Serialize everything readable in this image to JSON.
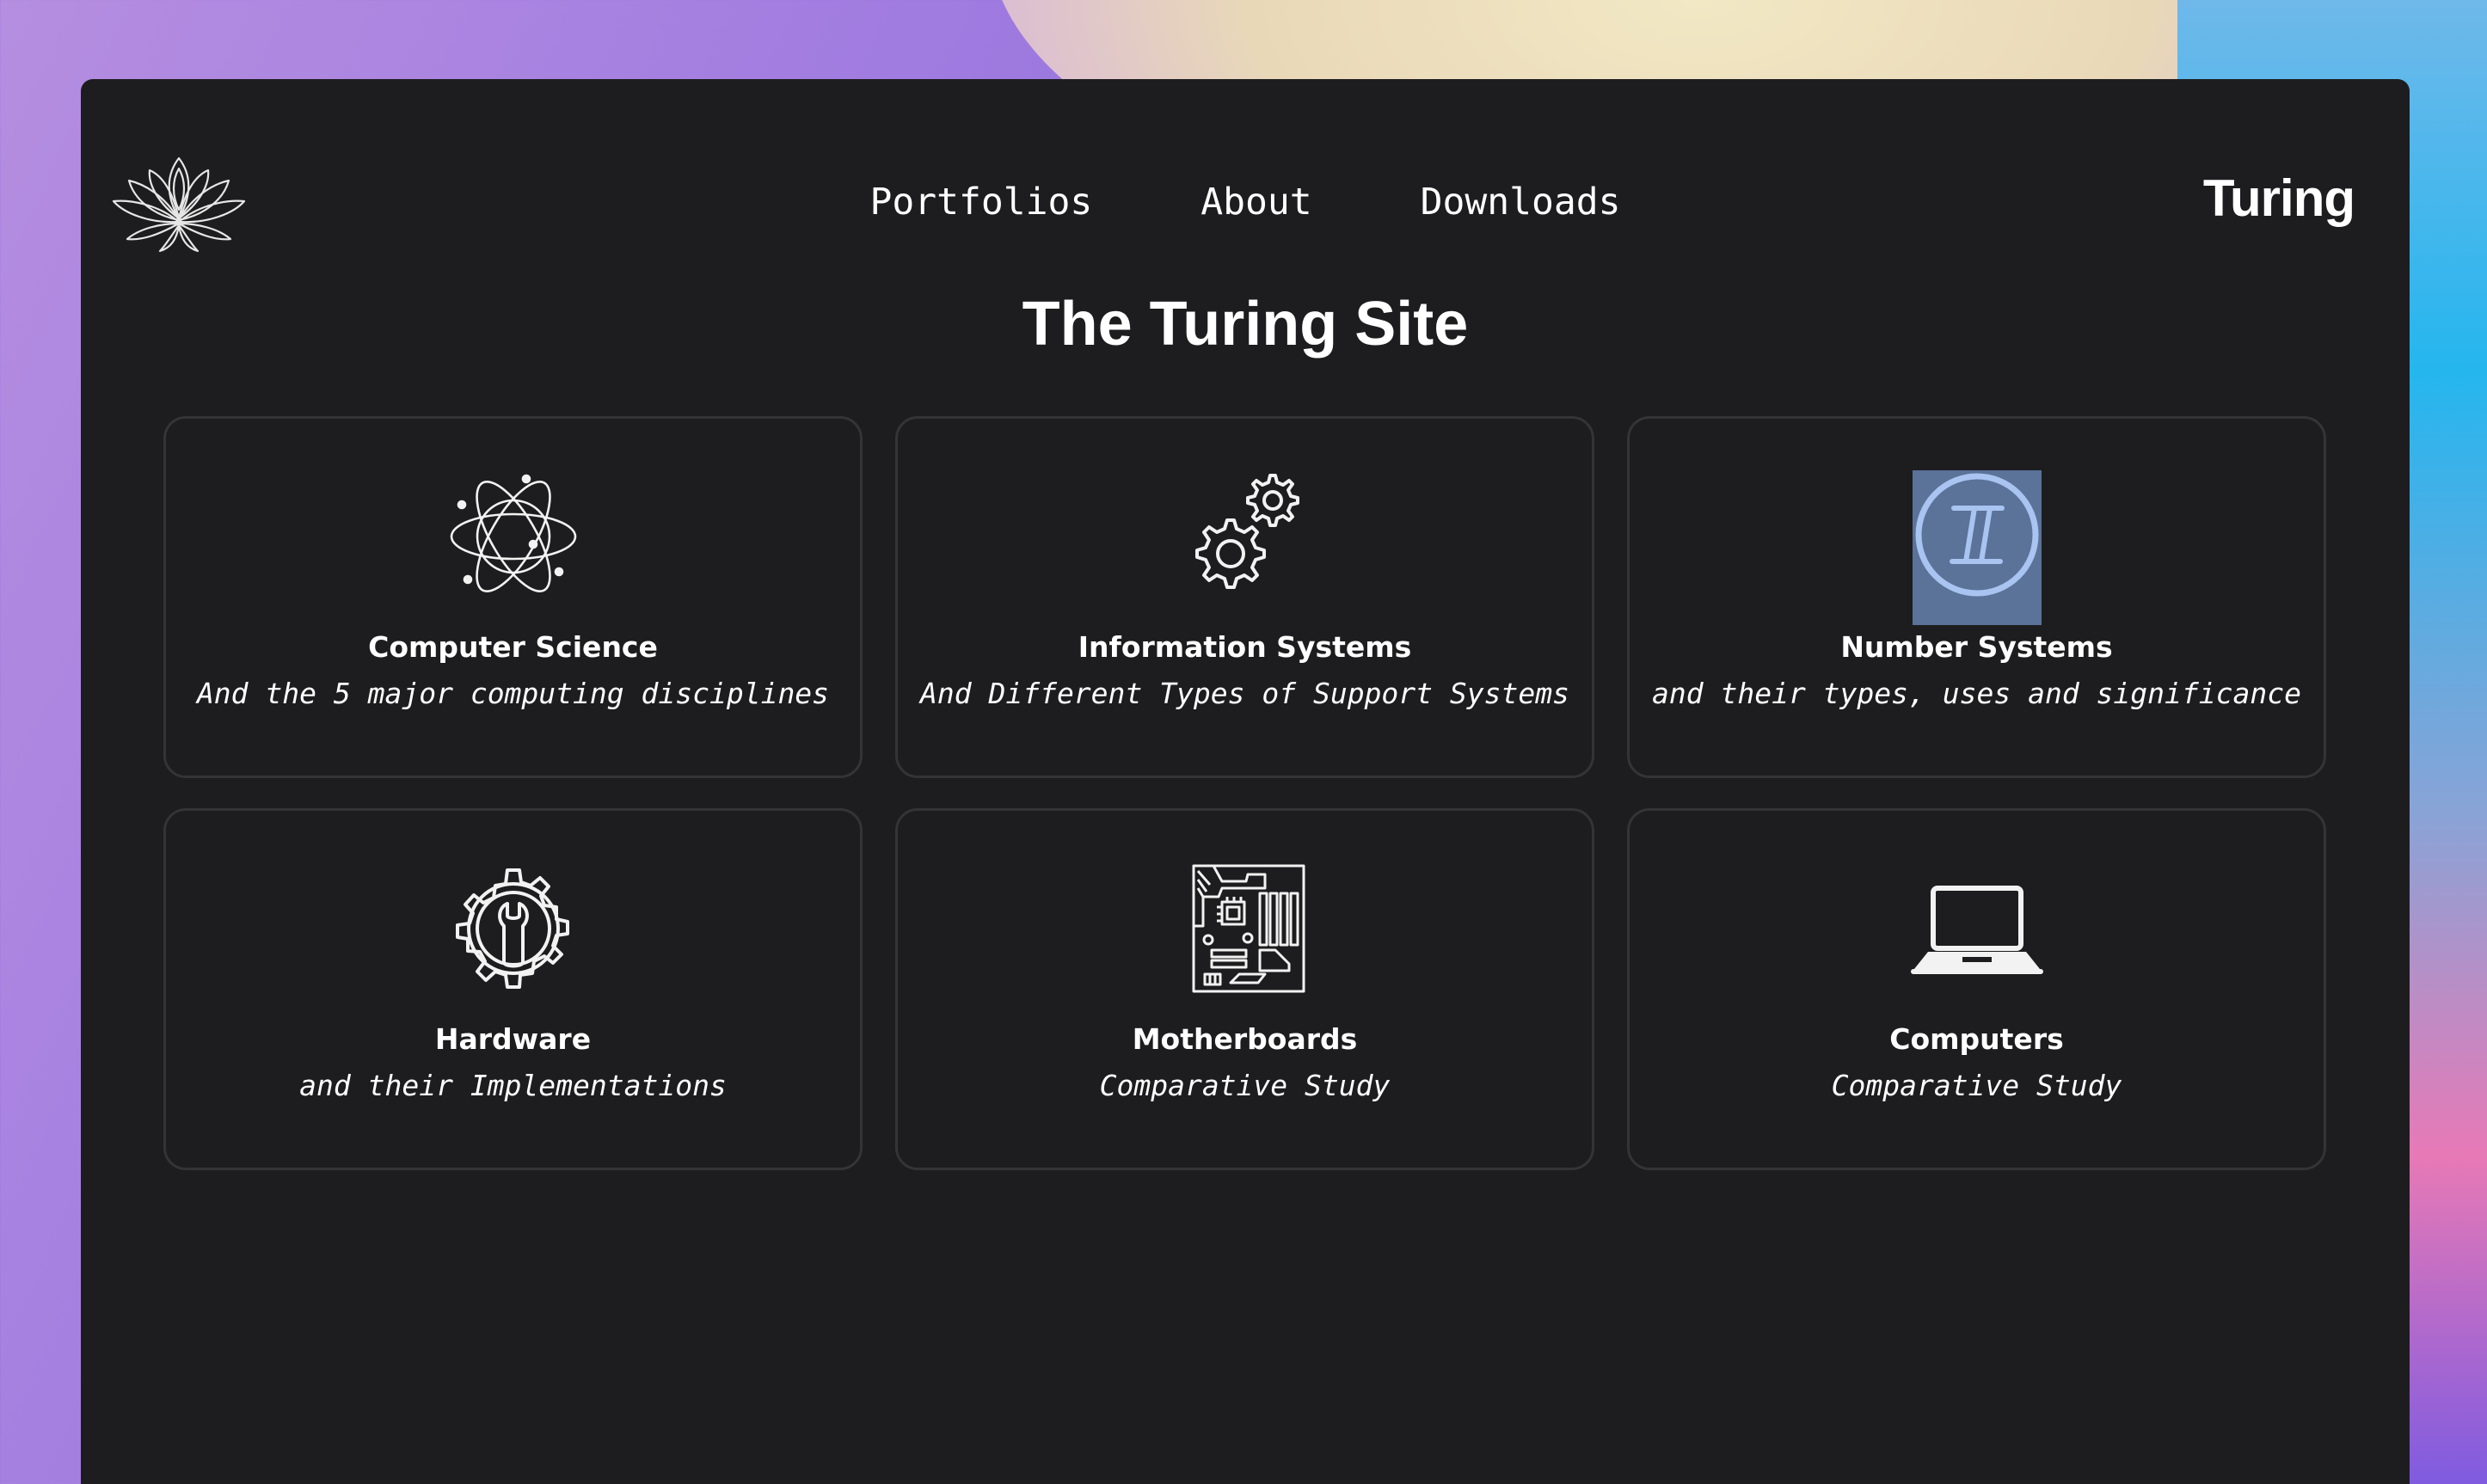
{
  "nav": {
    "items": [
      {
        "label": "Portfolios"
      },
      {
        "label": "About"
      },
      {
        "label": "Downloads"
      }
    ]
  },
  "brand": {
    "name": "Turing"
  },
  "page": {
    "title": "The Turing Site"
  },
  "cards": [
    {
      "title": "Computer Science",
      "subtitle": "And the 5 major computing disciplines",
      "icon": "atom-icon"
    },
    {
      "title": "Information Systems",
      "subtitle": "And Different Types of Support Systems",
      "icon": "gears-icon"
    },
    {
      "title": "Number Systems",
      "subtitle": "and their types, uses and significance",
      "icon": "roman-numeral-two-icon"
    },
    {
      "title": "Hardware",
      "subtitle": "and their Implementations",
      "icon": "wrench-gear-icon"
    },
    {
      "title": "Motherboards",
      "subtitle": "Comparative Study",
      "icon": "motherboard-icon"
    },
    {
      "title": "Computers",
      "subtitle": "Comparative Study",
      "icon": "laptop-icon"
    }
  ],
  "colors": {
    "window_bg": "#1d1d1f",
    "card_border": "#343436",
    "text": "#ffffff",
    "highlight": "#5b7299",
    "numeral_fg": "#a9c4f0"
  }
}
